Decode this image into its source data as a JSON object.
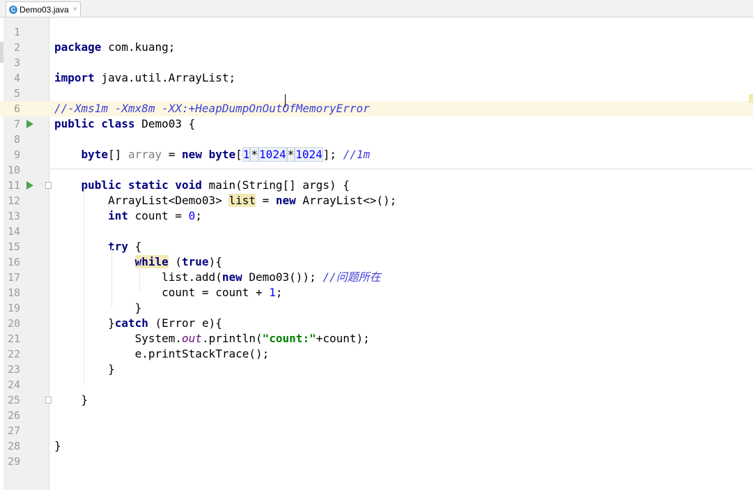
{
  "tab": {
    "filename": "Demo03.java",
    "icon": "C",
    "close": "×"
  },
  "lines": [
    {
      "n": "1",
      "tokens": []
    },
    {
      "n": "2",
      "tokens": [
        {
          "t": "package",
          "c": "kw"
        },
        {
          "t": " com.kuang;"
        }
      ]
    },
    {
      "n": "3",
      "tokens": []
    },
    {
      "n": "4",
      "tokens": [
        {
          "t": "import",
          "c": "kw"
        },
        {
          "t": " java.util.ArrayList;"
        }
      ]
    },
    {
      "n": "5",
      "tokens": []
    },
    {
      "n": "6",
      "current": true,
      "tokens": [
        {
          "t": "//-Xms1m -Xmx8m -XX:+HeapDumpOnOutOfMemoryError",
          "c": "cm"
        }
      ]
    },
    {
      "n": "7",
      "run": true,
      "tokens": [
        {
          "t": "public class",
          "c": "kw"
        },
        {
          "t": " Demo03 {"
        }
      ]
    },
    {
      "n": "8",
      "tokens": []
    },
    {
      "n": "9",
      "tokens": [
        {
          "t": "    "
        },
        {
          "t": "byte",
          "c": "kw"
        },
        {
          "t": "[] "
        },
        {
          "t": "array",
          "c": "unused"
        },
        {
          "t": " = "
        },
        {
          "t": "new",
          "c": "kw"
        },
        {
          "t": " "
        },
        {
          "t": "byte",
          "c": "kw"
        },
        {
          "t": "["
        },
        {
          "t": "1",
          "c": "num hl-num"
        },
        {
          "t": "*",
          "c": "hl-num"
        },
        {
          "t": "1024",
          "c": "num hl-num"
        },
        {
          "t": "*",
          "c": "hl-num"
        },
        {
          "t": "1024",
          "c": "num hl-num"
        },
        {
          "t": "]; "
        },
        {
          "t": "//1m",
          "c": "cm"
        }
      ]
    },
    {
      "n": "10",
      "tokens": []
    },
    {
      "n": "11",
      "run": true,
      "fold": true,
      "tokens": [
        {
          "t": "    "
        },
        {
          "t": "public static void",
          "c": "kw"
        },
        {
          "t": " main(String[] args) {"
        }
      ]
    },
    {
      "n": "12",
      "tokens": [
        {
          "t": "        ArrayList<Demo03> "
        },
        {
          "t": "list",
          "c": "hl-word"
        },
        {
          "t": " = "
        },
        {
          "t": "new",
          "c": "kw"
        },
        {
          "t": " ArrayList<>();"
        }
      ]
    },
    {
      "n": "13",
      "tokens": [
        {
          "t": "        "
        },
        {
          "t": "int",
          "c": "kw"
        },
        {
          "t": " count = "
        },
        {
          "t": "0",
          "c": "num"
        },
        {
          "t": ";"
        }
      ]
    },
    {
      "n": "14",
      "tokens": []
    },
    {
      "n": "15",
      "tokens": [
        {
          "t": "        "
        },
        {
          "t": "try",
          "c": "kw"
        },
        {
          "t": " {"
        }
      ]
    },
    {
      "n": "16",
      "tokens": [
        {
          "t": "            "
        },
        {
          "t": "while",
          "c": "kw hl-word"
        },
        {
          "t": " ("
        },
        {
          "t": "true",
          "c": "kw"
        },
        {
          "t": "){"
        }
      ]
    },
    {
      "n": "17",
      "tokens": [
        {
          "t": "                list.add("
        },
        {
          "t": "new",
          "c": "kw"
        },
        {
          "t": " Demo03()); "
        },
        {
          "t": "//问题所在",
          "c": "cm"
        }
      ]
    },
    {
      "n": "18",
      "tokens": [
        {
          "t": "                count = count + "
        },
        {
          "t": "1",
          "c": "num"
        },
        {
          "t": ";"
        }
      ]
    },
    {
      "n": "19",
      "tokens": [
        {
          "t": "            }"
        }
      ]
    },
    {
      "n": "20",
      "tokens": [
        {
          "t": "        }"
        },
        {
          "t": "catch",
          "c": "kw"
        },
        {
          "t": " (Error e){"
        }
      ]
    },
    {
      "n": "21",
      "tokens": [
        {
          "t": "            System."
        },
        {
          "t": "out",
          "c": "static-field"
        },
        {
          "t": ".println("
        },
        {
          "t": "\"count:\"",
          "c": "str"
        },
        {
          "t": "+count);"
        }
      ]
    },
    {
      "n": "22",
      "tokens": [
        {
          "t": "            e.printStackTrace();"
        }
      ]
    },
    {
      "n": "23",
      "tokens": [
        {
          "t": "        }"
        }
      ]
    },
    {
      "n": "24",
      "tokens": []
    },
    {
      "n": "25",
      "fold": true,
      "tokens": [
        {
          "t": "    }"
        }
      ]
    },
    {
      "n": "26",
      "tokens": []
    },
    {
      "n": "27",
      "tokens": []
    },
    {
      "n": "28",
      "tokens": [
        {
          "t": "}"
        }
      ]
    },
    {
      "n": "29",
      "tokens": []
    }
  ]
}
